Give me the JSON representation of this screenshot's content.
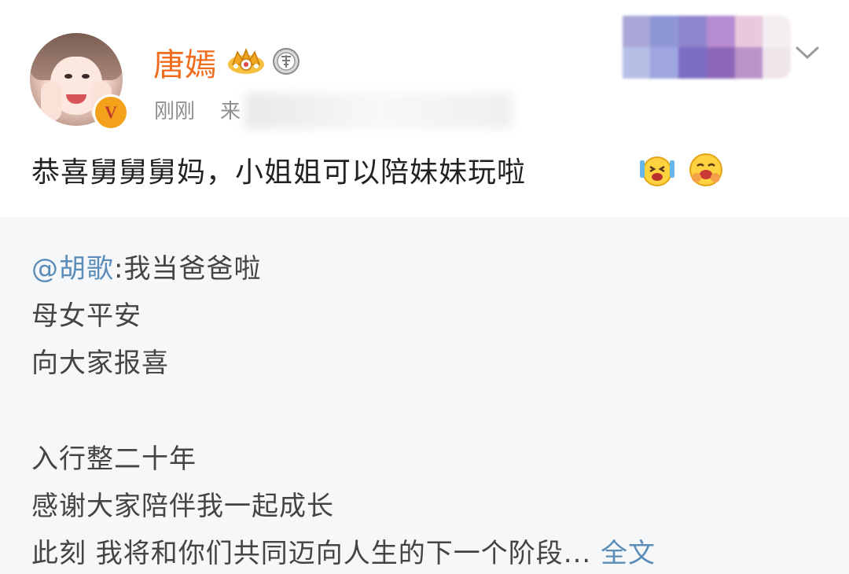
{
  "post": {
    "author": {
      "name": "唐嫣",
      "verified_badge": "V",
      "badges": [
        "crown-icon",
        "medal-icon"
      ]
    },
    "time": "刚刚",
    "source_prefix": "来",
    "text": "恭喜舅舅舅妈，小姐姐可以陪妹妹玩啦",
    "emojis": [
      "excited-face-emoji",
      "hugging-face-emoji"
    ],
    "menu_icon": "chevron-down-icon"
  },
  "repost": {
    "mention": "@胡歌",
    "first_line_rest": ":我当爸爸啦",
    "lines": [
      "母女平安",
      "向大家报喜"
    ],
    "lines2": [
      "入行整二十年",
      "感谢大家陪伴我一起成长"
    ],
    "last_line": "此刻 我将和你们共同迈向人生的下一个阶段...",
    "full_text_link": "全文"
  },
  "colors": {
    "username": "#f26a1b",
    "link": "#5b8db8",
    "repost_bg": "#f6f7f9",
    "meta": "#8e8e8e"
  }
}
